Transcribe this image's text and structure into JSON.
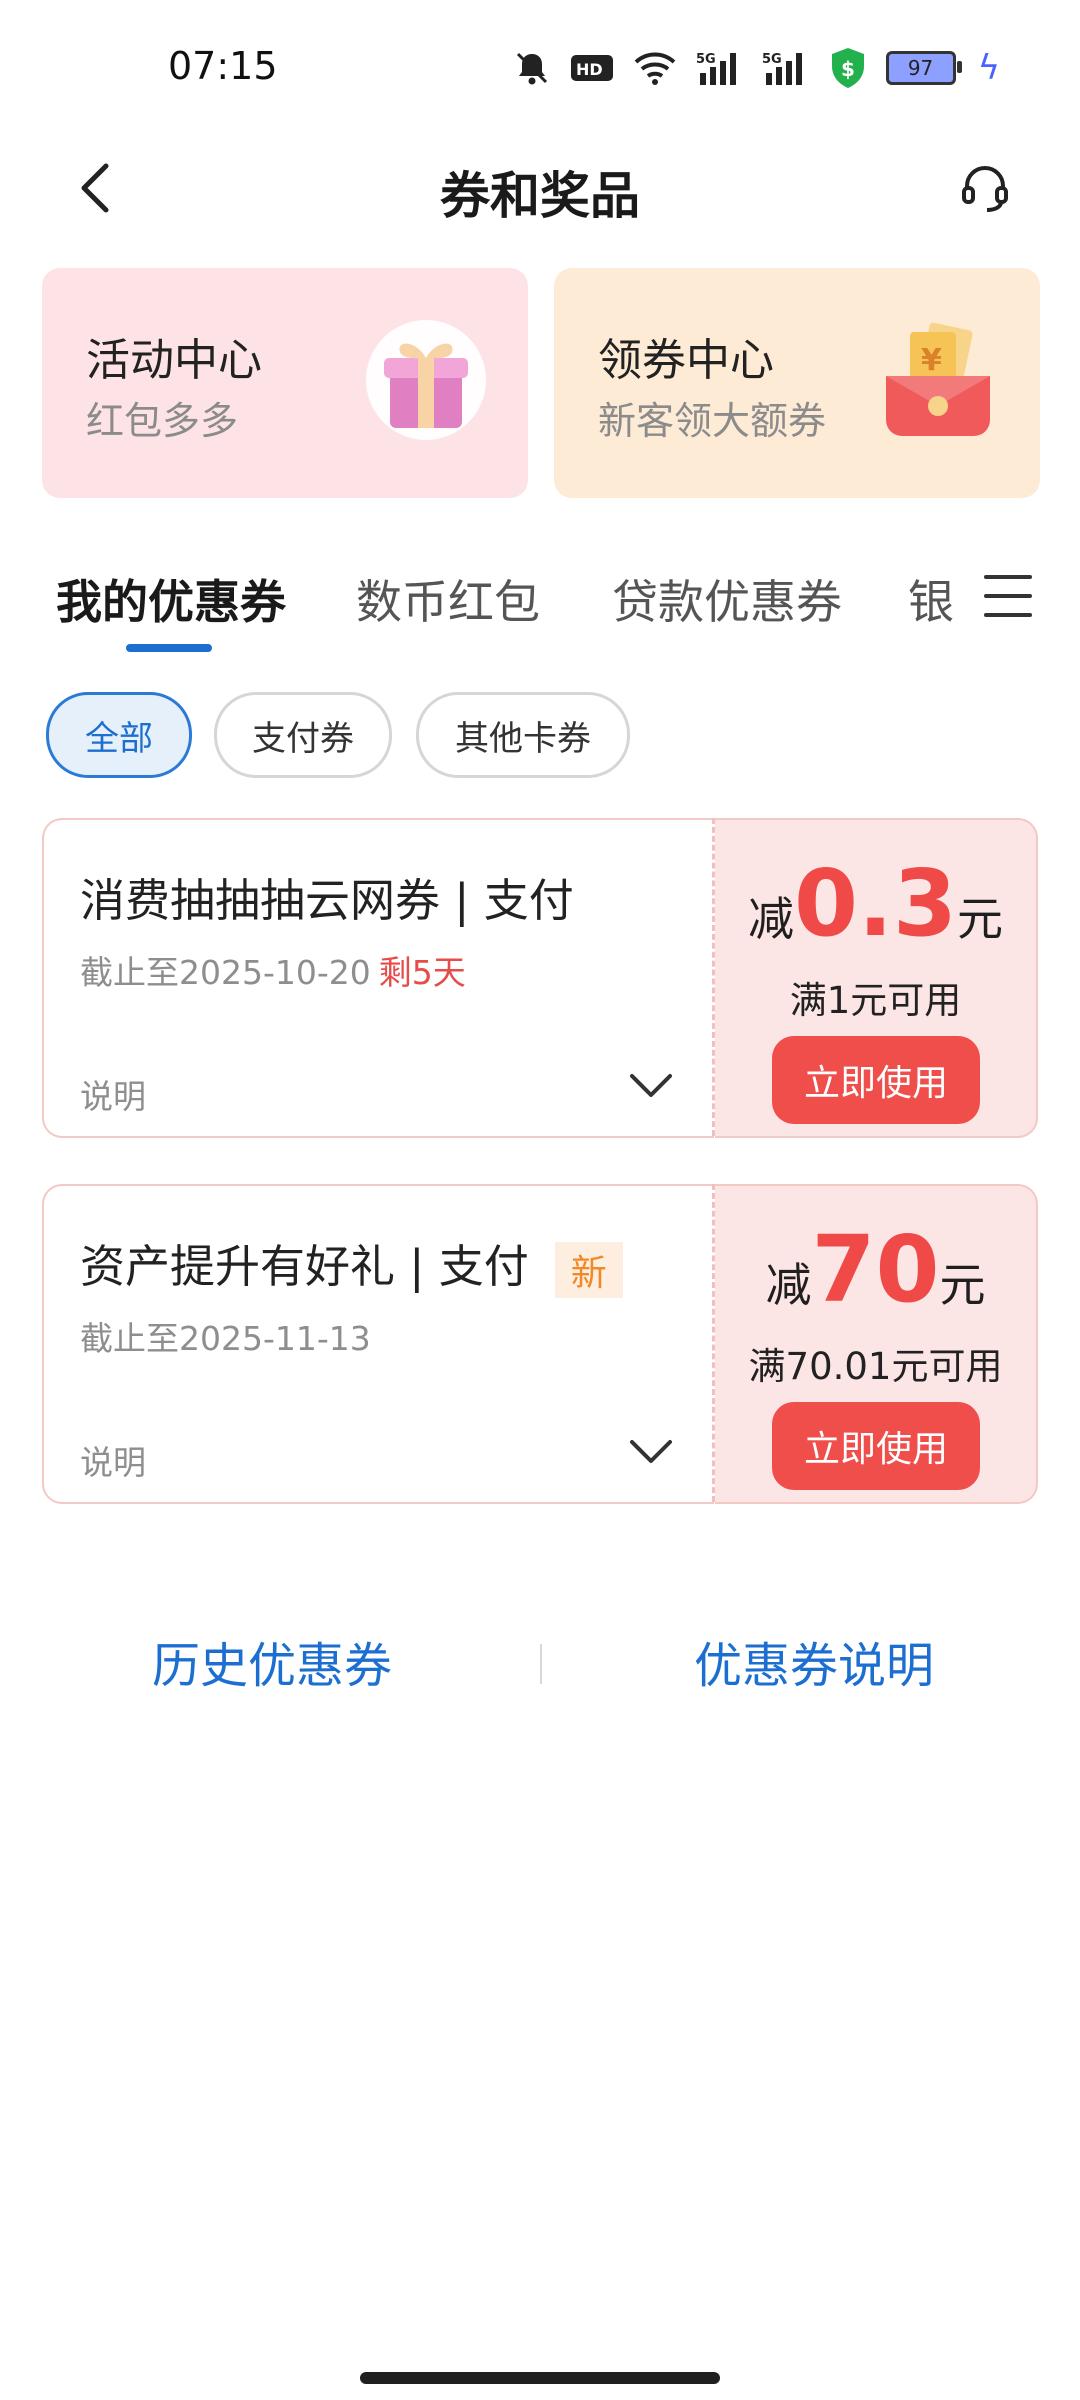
{
  "status_bar": {
    "time": "07:15",
    "icons": [
      "bell-off-icon",
      "hd-icon",
      "wifi-icon",
      "signal-5g-icon",
      "signal-5g-icon-2",
      "shield-dollar-icon"
    ],
    "battery": "97"
  },
  "header": {
    "title": "券和奖品",
    "back_icon": "chevron-left-icon",
    "service_icon": "headset-icon"
  },
  "promo_cards": [
    {
      "title": "活动中心",
      "subtitle": "红包多多",
      "icon": "gift-box-icon",
      "bg": "#fde3e5"
    },
    {
      "title": "领券中心",
      "subtitle": "新客领大额券",
      "icon": "red-envelope-icon",
      "bg": "#fdebd6"
    }
  ],
  "tabs": [
    "我的优惠券",
    "数币红包",
    "贷款优惠券",
    "银"
  ],
  "filters": [
    "全部",
    "支付券",
    "其他卡券"
  ],
  "coupons": [
    {
      "name": "消费抽抽抽云网券 | 支付",
      "deadline": "截止至2025-10-20",
      "remaining": "剩5天",
      "badge": "",
      "desc_label": "说明",
      "prefix": "减",
      "amount": "0.3",
      "unit": "元",
      "condition": "满1元可用",
      "button": "立即使用"
    },
    {
      "name": "资产提升有好礼 | 支付",
      "deadline": "截止至2025-11-13",
      "remaining": "",
      "badge": "新",
      "desc_label": "说明",
      "prefix": "减",
      "amount": "70",
      "unit": "元",
      "condition": "满70.01元可用",
      "button": "立即使用"
    }
  ],
  "footer": {
    "history": "历史优惠券",
    "explain": "优惠券说明"
  },
  "colors": {
    "accent_blue": "#1c6fd1",
    "accent_red": "#ef4a48"
  }
}
